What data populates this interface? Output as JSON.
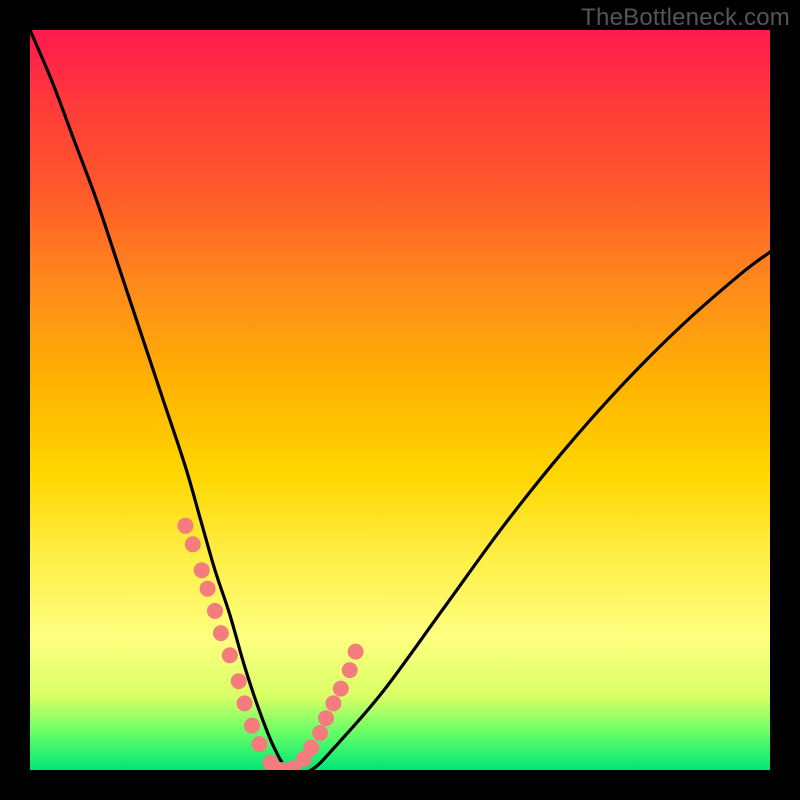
{
  "watermark": "TheBottleneck.com",
  "colors": {
    "frame": "#000000",
    "gradient_top": "#ff1a4d",
    "gradient_bottom": "#00e676",
    "curve": "#000000",
    "marker": "#f47c7c"
  },
  "chart_data": {
    "type": "line",
    "title": "",
    "xlabel": "",
    "ylabel": "",
    "xlim": [
      0,
      100
    ],
    "ylim": [
      0,
      100
    ],
    "grid": false,
    "legend": false,
    "series": [
      {
        "name": "bottleneck-curve",
        "x": [
          0,
          3,
          6,
          9,
          12,
          15,
          18,
          21,
          23,
          25,
          27,
          29,
          31,
          33,
          35,
          38,
          42,
          48,
          56,
          64,
          72,
          80,
          88,
          96,
          100
        ],
        "y": [
          100,
          93,
          85,
          77,
          68,
          59,
          50,
          41,
          34,
          27,
          21,
          14,
          8,
          3,
          0,
          0,
          4,
          11,
          22,
          33,
          43,
          52,
          60,
          67,
          70
        ]
      }
    ],
    "markers": {
      "name": "highlight-points",
      "x": [
        21,
        22,
        23.2,
        24,
        25,
        25.8,
        27,
        28.2,
        29,
        30,
        31,
        32.5,
        34,
        35.5,
        37,
        38,
        39.2,
        40,
        41,
        42,
        43.2,
        44
      ],
      "y": [
        33,
        30.5,
        27,
        24.5,
        21.5,
        18.5,
        15.5,
        12,
        9,
        6,
        3.5,
        1,
        0,
        0.2,
        1.5,
        3,
        5,
        7,
        9,
        11,
        13.5,
        16
      ]
    }
  }
}
